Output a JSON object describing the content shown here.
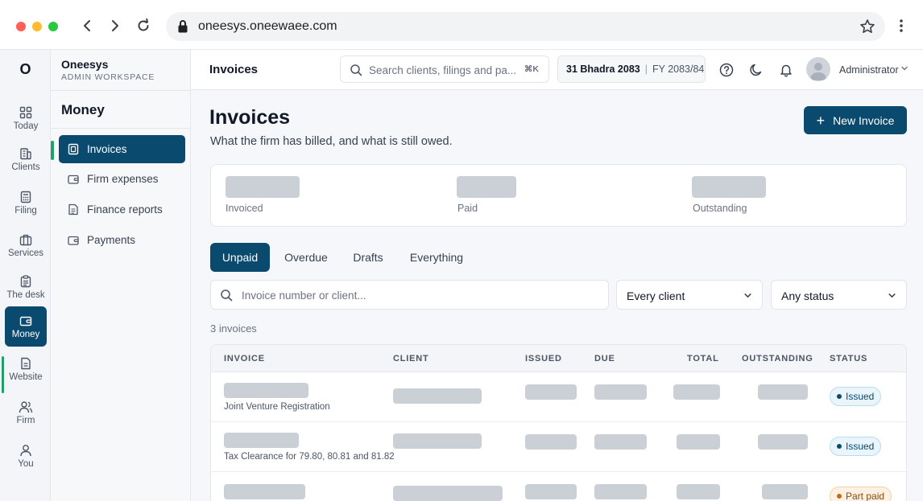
{
  "browser": {
    "url": "oneesys.oneewaee.com"
  },
  "rail": {
    "logo": "O",
    "items": [
      {
        "label": "Today",
        "icon": "grid-icon",
        "active": false
      },
      {
        "label": "Clients",
        "icon": "building-icon",
        "active": false
      },
      {
        "label": "Filing",
        "icon": "calculator-icon",
        "active": false
      },
      {
        "label": "Services",
        "icon": "briefcase-icon",
        "active": false
      },
      {
        "label": "The desk",
        "icon": "clipboard-icon",
        "active": false
      },
      {
        "label": "Money",
        "icon": "wallet-icon",
        "active": true
      },
      {
        "label": "Website",
        "icon": "page-icon",
        "active": false
      },
      {
        "label": "Firm",
        "icon": "users-icon",
        "active": false
      },
      {
        "label": "You",
        "icon": "user-icon",
        "active": false
      }
    ]
  },
  "workspace": {
    "name": "Oneesys",
    "subtitle": "ADMIN WORKSPACE"
  },
  "sidebar": {
    "section": "Money",
    "items": [
      {
        "label": "Invoices",
        "icon": "invoice-icon",
        "active": true
      },
      {
        "label": "Firm expenses",
        "icon": "wallet-icon",
        "active": false
      },
      {
        "label": "Finance reports",
        "icon": "report-icon",
        "active": false
      },
      {
        "label": "Payments",
        "icon": "wallet-icon",
        "active": false
      }
    ]
  },
  "header": {
    "title": "Invoices",
    "search_placeholder": "Search clients, filings and pa...",
    "search_shortcut": "⌘K",
    "date": "31 Bhadra 2083",
    "fiscal_year": "FY 2083/84",
    "user": "Administrator"
  },
  "page": {
    "title": "Invoices",
    "subtitle": "What the firm has billed, and what is still owed.",
    "new_button": "New Invoice"
  },
  "stats": [
    {
      "label": "Invoiced"
    },
    {
      "label": "Paid"
    },
    {
      "label": "Outstanding"
    }
  ],
  "tabs": [
    {
      "label": "Unpaid",
      "active": true
    },
    {
      "label": "Overdue",
      "active": false
    },
    {
      "label": "Drafts",
      "active": false
    },
    {
      "label": "Everything",
      "active": false
    }
  ],
  "filters": {
    "search_placeholder": "Invoice number or client...",
    "client_select": "Every client",
    "status_select": "Any status"
  },
  "count_text": "3 invoices",
  "table": {
    "columns": [
      "INVOICE",
      "CLIENT",
      "ISSUED",
      "DUE",
      "TOTAL",
      "OUTSTANDING",
      "STATUS"
    ],
    "rows": [
      {
        "description": "Joint Venture Registration",
        "status": "Issued"
      },
      {
        "description": "Tax Clearance for 79.80, 80.81 and 81.82",
        "status": "Issued"
      },
      {
        "description": "",
        "status": "Part paid"
      }
    ]
  },
  "colors": {
    "primary": "#0b4a6f",
    "accent_green": "#22a06b",
    "skeleton": "#cbd0d7"
  }
}
